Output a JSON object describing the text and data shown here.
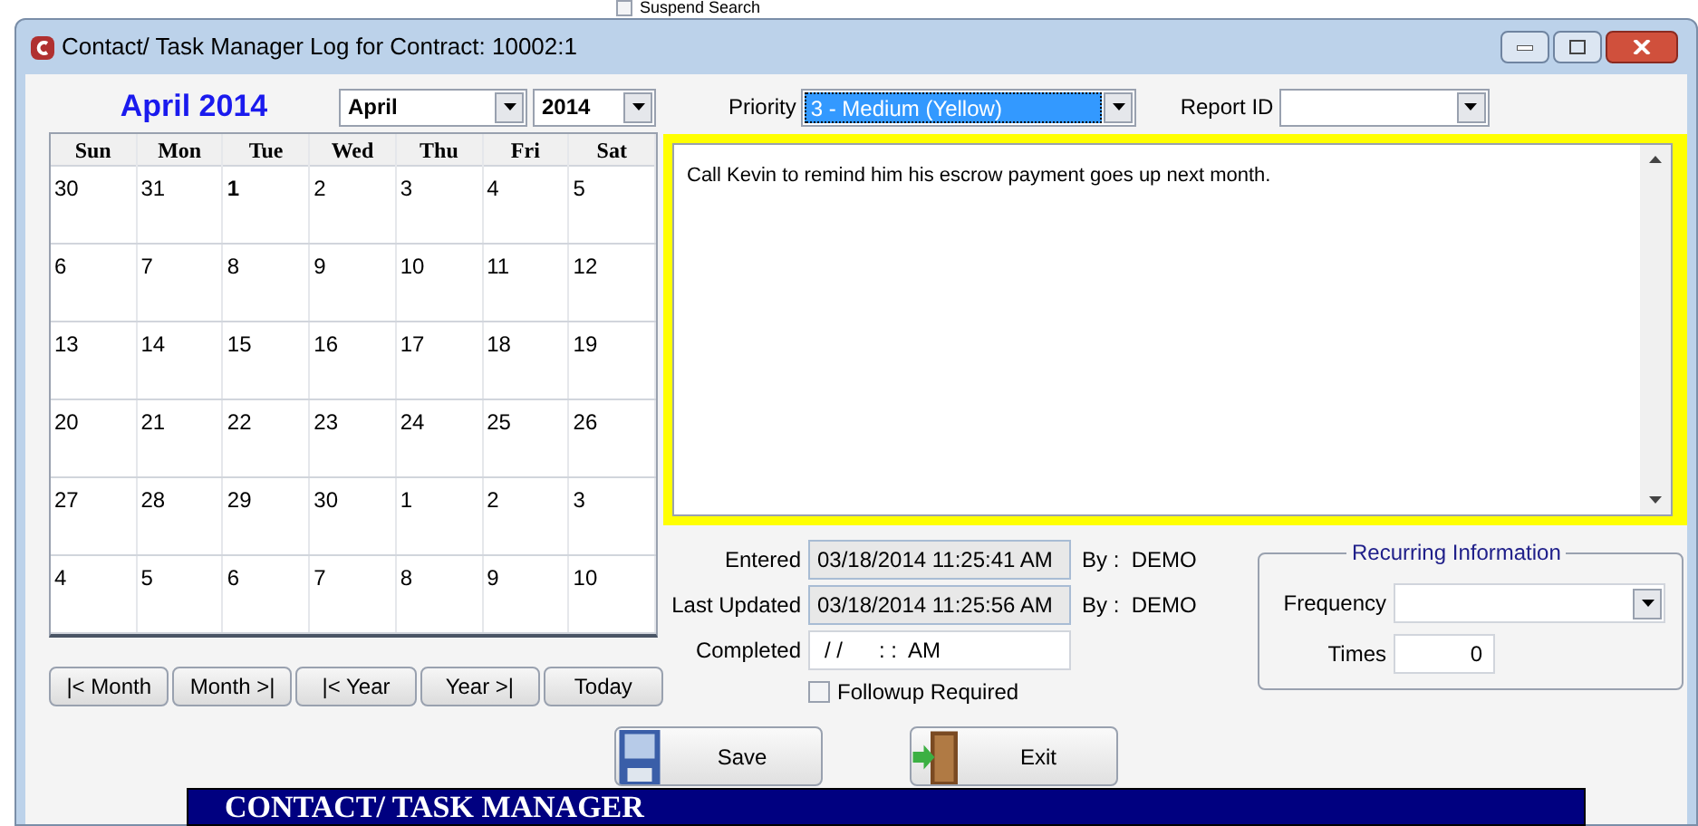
{
  "background": {
    "checkbox_label": "Suspend Search",
    "checked": false
  },
  "window": {
    "title": "Contact/ Task Manager Log for Contract: 10002:1"
  },
  "calendar": {
    "heading": "April 2014",
    "month_select": "April",
    "year_select": "2014",
    "weekdays": [
      "Sun",
      "Mon",
      "Tue",
      "Wed",
      "Thu",
      "Fri",
      "Sat"
    ],
    "weeks": [
      [
        {
          "day": "30",
          "today": false
        },
        {
          "day": "31",
          "today": false
        },
        {
          "day": "1",
          "today": true
        },
        {
          "day": "2",
          "today": false
        },
        {
          "day": "3",
          "today": false
        },
        {
          "day": "4",
          "today": false
        },
        {
          "day": "5",
          "today": false
        }
      ],
      [
        {
          "day": "6",
          "today": false
        },
        {
          "day": "7",
          "today": false
        },
        {
          "day": "8",
          "today": false
        },
        {
          "day": "9",
          "today": false
        },
        {
          "day": "10",
          "today": false
        },
        {
          "day": "11",
          "today": false
        },
        {
          "day": "12",
          "today": false
        }
      ],
      [
        {
          "day": "13",
          "today": false
        },
        {
          "day": "14",
          "today": false
        },
        {
          "day": "15",
          "today": false
        },
        {
          "day": "16",
          "today": false
        },
        {
          "day": "17",
          "today": false
        },
        {
          "day": "18",
          "today": false
        },
        {
          "day": "19",
          "today": false
        }
      ],
      [
        {
          "day": "20",
          "today": false
        },
        {
          "day": "21",
          "today": false
        },
        {
          "day": "22",
          "today": false
        },
        {
          "day": "23",
          "today": false
        },
        {
          "day": "24",
          "today": false
        },
        {
          "day": "25",
          "today": false
        },
        {
          "day": "26",
          "today": false
        }
      ],
      [
        {
          "day": "27",
          "today": false
        },
        {
          "day": "28",
          "today": false
        },
        {
          "day": "29",
          "today": false
        },
        {
          "day": "30",
          "today": false
        },
        {
          "day": "1",
          "today": false
        },
        {
          "day": "2",
          "today": false
        },
        {
          "day": "3",
          "today": false
        }
      ],
      [
        {
          "day": "4",
          "today": false
        },
        {
          "day": "5",
          "today": false
        },
        {
          "day": "6",
          "today": false
        },
        {
          "day": "7",
          "today": false
        },
        {
          "day": "8",
          "today": false
        },
        {
          "day": "9",
          "today": false
        },
        {
          "day": "10",
          "today": false
        }
      ]
    ],
    "buttons": [
      "|< Month",
      "Month >|",
      "|< Year",
      "Year >|",
      "Today"
    ]
  },
  "priority": {
    "label": "Priority",
    "value": "3 - Medium (Yellow)"
  },
  "report_id": {
    "label": "Report ID"
  },
  "note": "Call Kevin to remind him his escrow payment goes up next month.",
  "entered": {
    "label": "Entered",
    "value": "03/18/2014 11:25:41 AM",
    "by": "By :  DEMO"
  },
  "last_updated": {
    "label": "Last Updated",
    "value": "03/18/2014 11:25:56 AM",
    "by": "By :  DEMO"
  },
  "completed": {
    "label": "Completed",
    "value": "/ /      : :  AM"
  },
  "followup": {
    "label": "Followup Required",
    "checked": false
  },
  "recurring": {
    "title": "Recurring Information",
    "frequency_label": "Frequency",
    "times_label": "Times",
    "times": "0"
  },
  "actions": [
    {
      "kind": "save",
      "label": "Save"
    },
    {
      "kind": "exit",
      "label": "Exit"
    }
  ],
  "banner": "CONTACT/ TASK MANAGER"
}
